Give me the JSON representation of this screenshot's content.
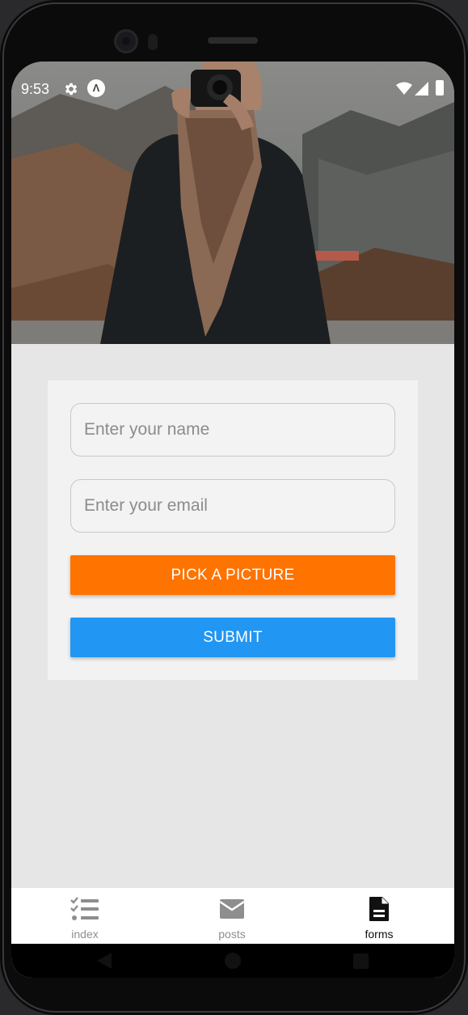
{
  "status_bar": {
    "time": "9:53",
    "settings_icon": "gear-icon",
    "app_icon": "expo-app-icon",
    "app_icon_glyph": "Λ"
  },
  "hero": {
    "image": "photographer-with-camera-photo"
  },
  "form": {
    "name_placeholder": "Enter your name",
    "email_placeholder": "Enter your email",
    "pick_label": "PICK A PICTURE",
    "submit_label": "SUBMIT",
    "colors": {
      "pick": "#ff7300",
      "submit": "#2196f3"
    }
  },
  "tabs": [
    {
      "label": "index",
      "icon": "checklist-icon",
      "active": false
    },
    {
      "label": "posts",
      "icon": "mail-icon",
      "active": false
    },
    {
      "label": "forms",
      "icon": "document-icon",
      "active": true
    }
  ],
  "navigation": {
    "back": "back-triangle-icon",
    "home": "home-circle-icon",
    "recents": "recents-square-icon"
  }
}
